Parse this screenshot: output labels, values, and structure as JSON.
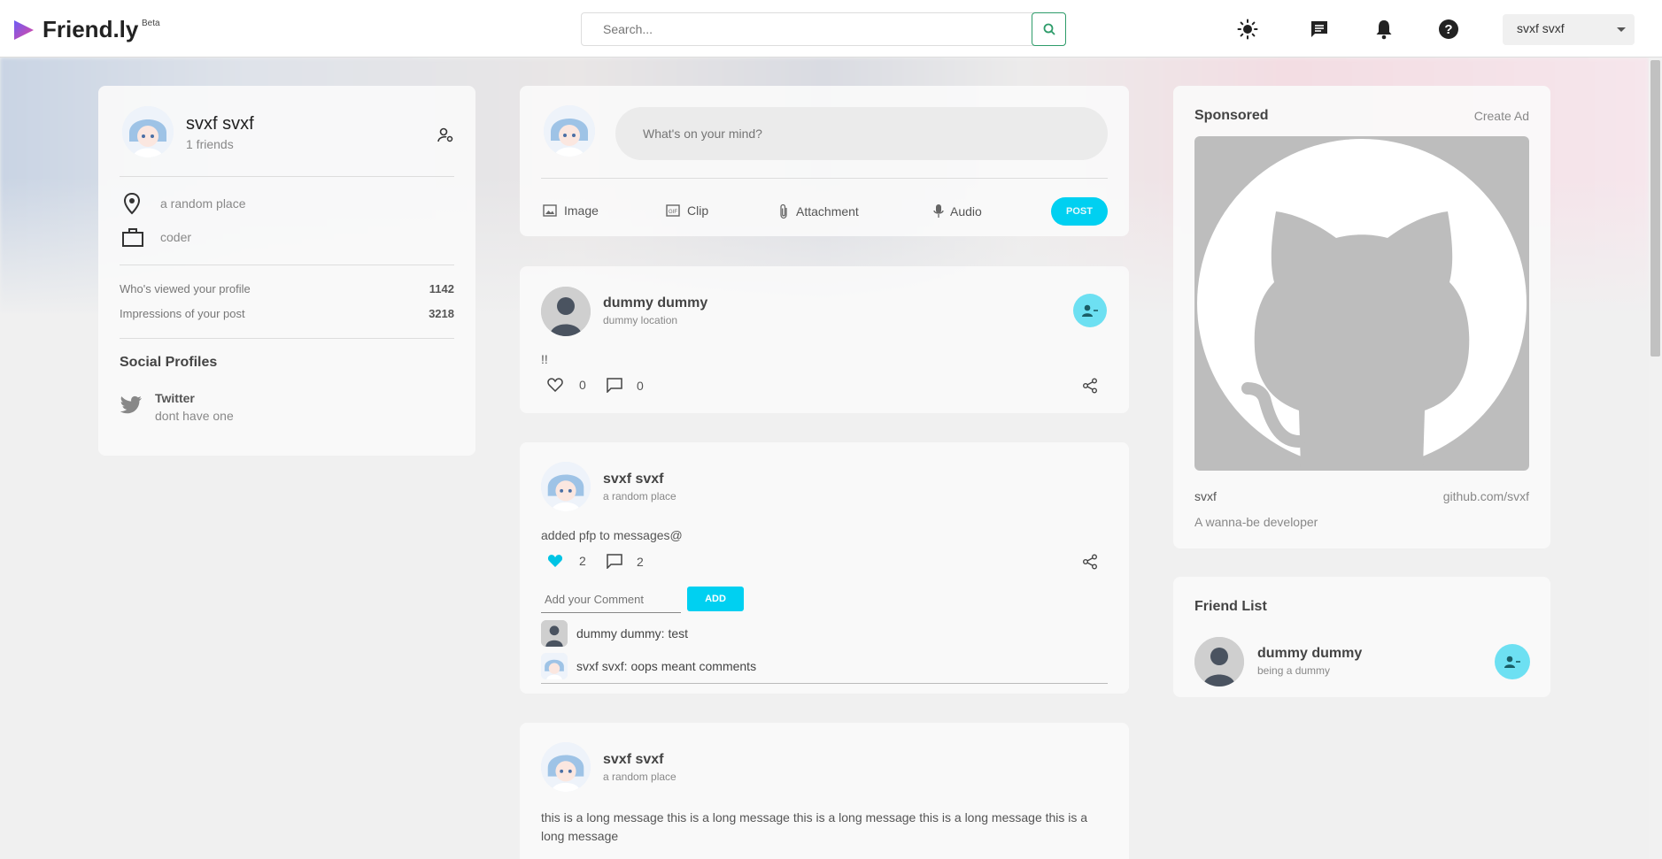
{
  "brand": {
    "name": "Friend.ly",
    "badge": "Beta"
  },
  "search": {
    "placeholder": "Search..."
  },
  "nav": {
    "icons": [
      "sun-icon",
      "message-icon",
      "bell-icon",
      "help-icon"
    ],
    "user_select": "svxf svxf"
  },
  "profile": {
    "name": "svxf svxf",
    "friends": "1 friends",
    "location": "a random place",
    "occupation": "coder",
    "stats": [
      {
        "label": "Who's viewed your profile",
        "value": "1142"
      },
      {
        "label": "Impressions of your post",
        "value": "3218"
      }
    ],
    "social_title": "Social Profiles",
    "social": {
      "name": "Twitter",
      "value": "dont have one"
    }
  },
  "composer": {
    "placeholder": "What's on your mind?",
    "actions": [
      "Image",
      "Clip",
      "Attachment",
      "Audio"
    ],
    "post_label": "POST"
  },
  "posts": [
    {
      "author": "dummy dummy",
      "location": "dummy location",
      "text": "!!",
      "likes": "0",
      "comments": "0"
    },
    {
      "author": "svxf svxf",
      "location": "a random place",
      "text": "added pfp to messages@",
      "likes": "2",
      "comments": "2",
      "comment_placeholder": "Add your Comment",
      "add_label": "ADD",
      "comment_list": [
        "dummy dummy: test",
        "svxf svxf: oops meant comments"
      ]
    },
    {
      "author": "svxf svxf",
      "location": "a random place",
      "text": "this is a long message this is a long message this is a long message this is a long message this is a long message"
    }
  ],
  "sponsored": {
    "title": "Sponsored",
    "create": "Create Ad",
    "name": "svxf",
    "link": "github.com/svxf",
    "desc": "A wanna-be developer"
  },
  "friend_list": {
    "title": "Friend List",
    "friends": [
      {
        "name": "dummy dummy",
        "subtitle": "being a dummy"
      }
    ]
  },
  "colors": {
    "accent": "#00d0f1",
    "accent_light": "#6de0f2",
    "search_border": "#2e9c6a"
  }
}
